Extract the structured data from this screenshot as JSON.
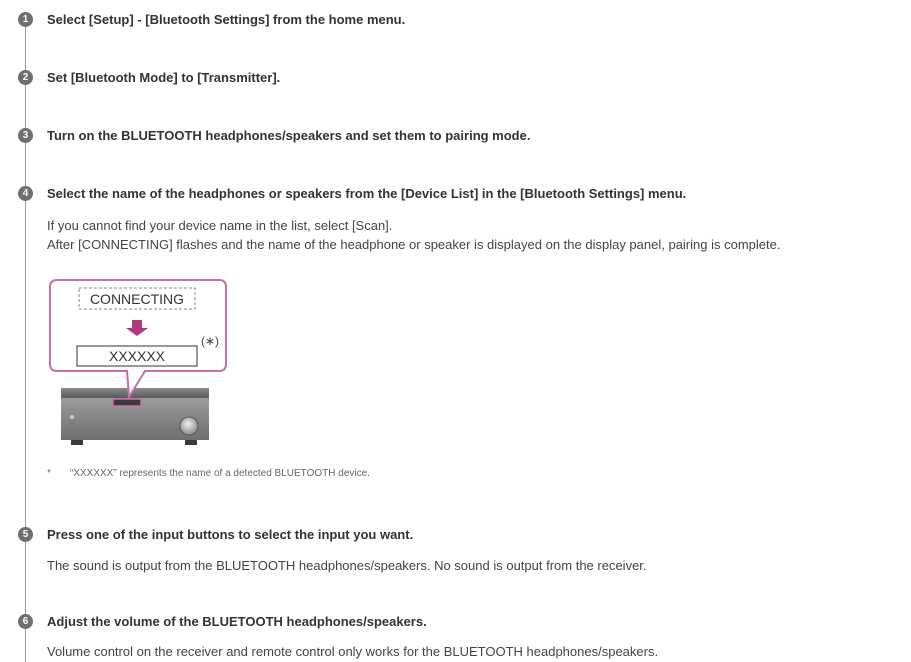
{
  "steps": [
    {
      "number": "1",
      "title": "Select [Setup] - [Bluetooth Settings] from the home menu."
    },
    {
      "number": "2",
      "title": "Set [Bluetooth Mode] to [Transmitter]."
    },
    {
      "number": "3",
      "title": "Turn on the BLUETOOTH headphones/speakers and set them to pairing mode."
    },
    {
      "number": "4",
      "title": "Select the name of the headphones or speakers from the [Device List] in the [Bluetooth Settings] menu.",
      "body": [
        "If you cannot find your device name in the list, select [Scan].",
        "After [CONNECTING] flashes and the name of the headphone or speaker is displayed on the display panel, pairing is complete."
      ]
    },
    {
      "number": "5",
      "title": "Press one of the input buttons to select the input you want.",
      "body": [
        "The sound is output from the BLUETOOTH headphones/speakers. No sound is output from the receiver."
      ]
    },
    {
      "number": "6",
      "title": "Adjust the volume of the BLUETOOTH headphones/speakers.",
      "body": [
        "Volume control on the receiver and remote control only works for the BLUETOOTH headphones/speakers."
      ]
    }
  ],
  "illustration": {
    "connecting_label": "CONNECTING",
    "device_name_label": "XXXXXX",
    "asterisk_label": "(∗)",
    "callout_color": "#c86fa8",
    "arrow_color": "#b03a7a"
  },
  "footnote": {
    "mark": "*",
    "text": "“XXXXXX” represents the name of a detected BLUETOOTH device."
  }
}
